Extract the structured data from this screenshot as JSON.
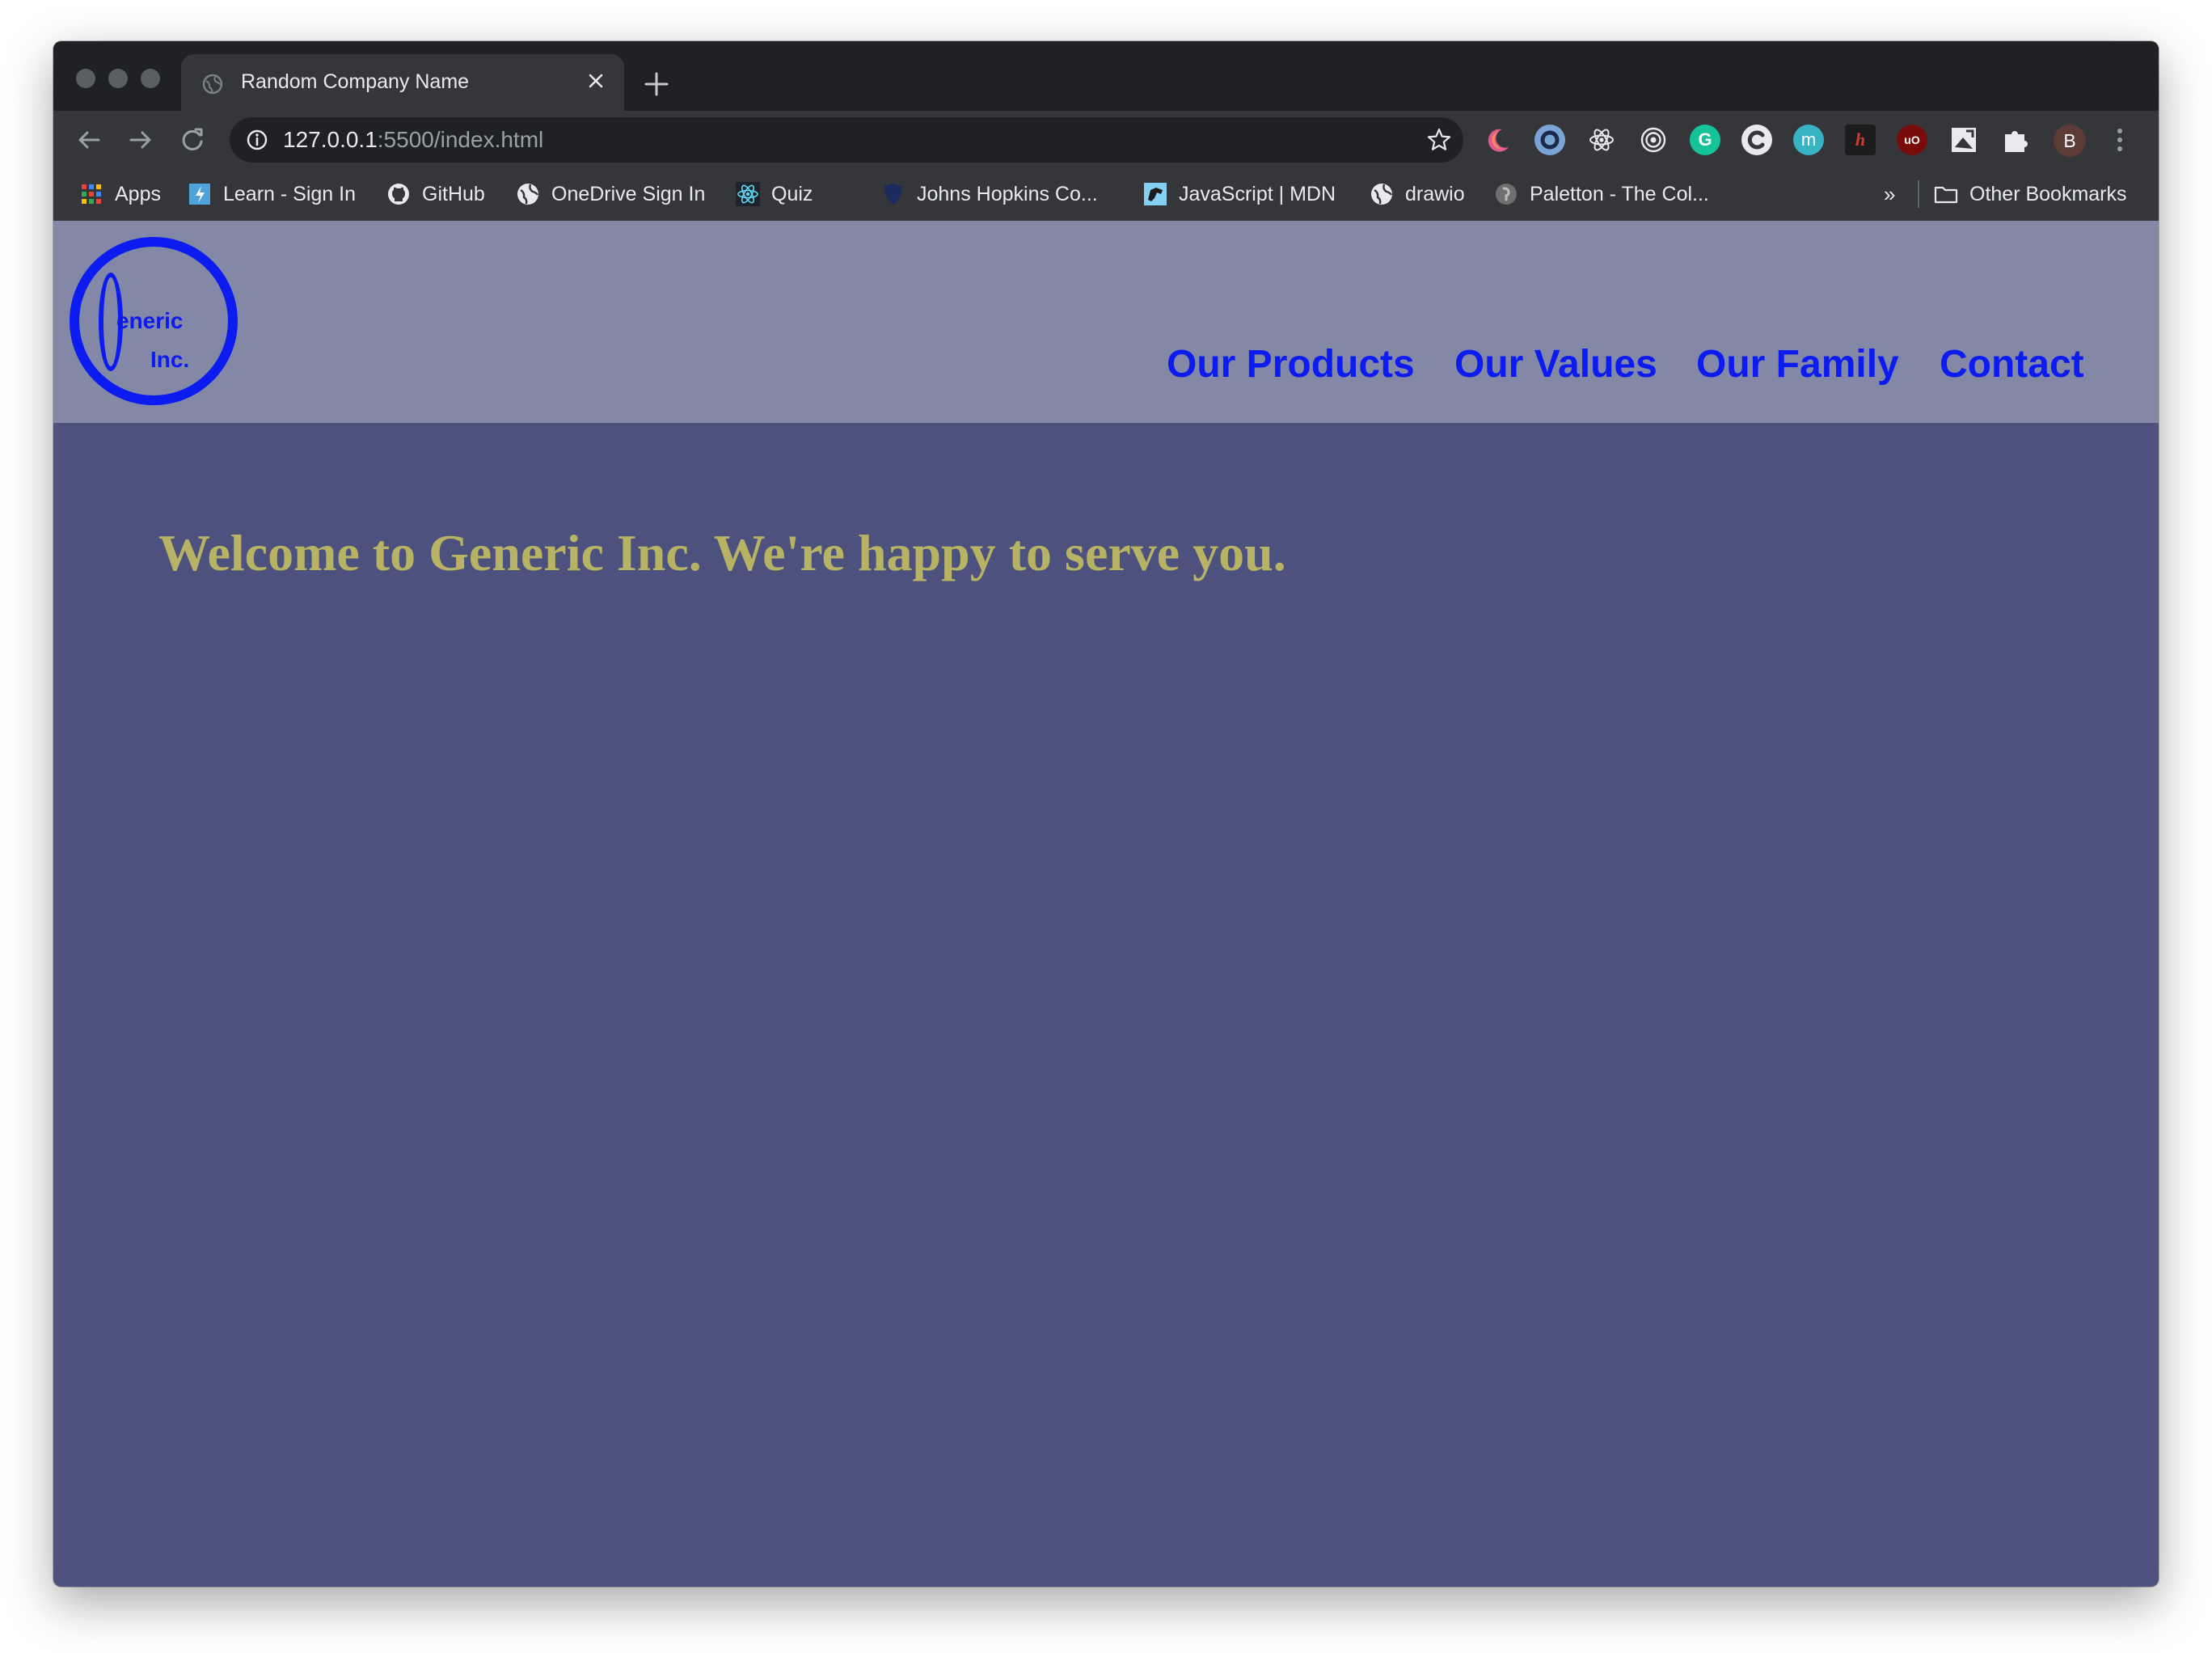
{
  "colors": {
    "chrome_dark": "#202124",
    "chrome_toolbar": "#35363a",
    "header_bg": "#8388a6",
    "main_bg": "#4c527d",
    "nav_link": "#0c1bf0",
    "welcome_text": "#b8b364"
  },
  "browser": {
    "tab": {
      "title": "Random Company Name",
      "favicon": "globe-icon"
    },
    "omnibox": {
      "host": "127.0.0.1",
      "rest": ":5500/index.html"
    },
    "avatar_initial": "B",
    "extensions": [
      "moon-icon",
      "ring-icon",
      "react-icon",
      "target-icon",
      "grammarly-icon",
      "c-icon",
      "m-icon",
      "h-icon",
      "ublock-icon",
      "screenshot-icon",
      "puzzle-icon"
    ],
    "bookmarks": [
      {
        "label": "Apps",
        "icon": "apps-grid-icon"
      },
      {
        "label": "Learn - Sign In",
        "icon": "learn-icon"
      },
      {
        "label": "GitHub",
        "icon": "github-icon"
      },
      {
        "label": "OneDrive Sign In",
        "icon": "globe-icon"
      },
      {
        "label": "Quiz",
        "icon": "react-icon"
      },
      {
        "label": "Johns Hopkins Co...",
        "icon": "shield-icon"
      },
      {
        "label": "JavaScript | MDN",
        "icon": "mdn-icon"
      },
      {
        "label": "drawio",
        "icon": "globe-icon"
      },
      {
        "label": "Paletton - The Col...",
        "icon": "paletton-icon"
      }
    ],
    "more_bookmarks": "»",
    "other_bookmarks": "Other Bookmarks"
  },
  "site": {
    "logo": {
      "line1": "eneric",
      "line2": "Inc."
    },
    "nav": [
      "Our Products",
      "Our Values",
      "Our Family",
      "Contact"
    ],
    "welcome": "Welcome to Generic Inc. We're happy to serve you."
  }
}
